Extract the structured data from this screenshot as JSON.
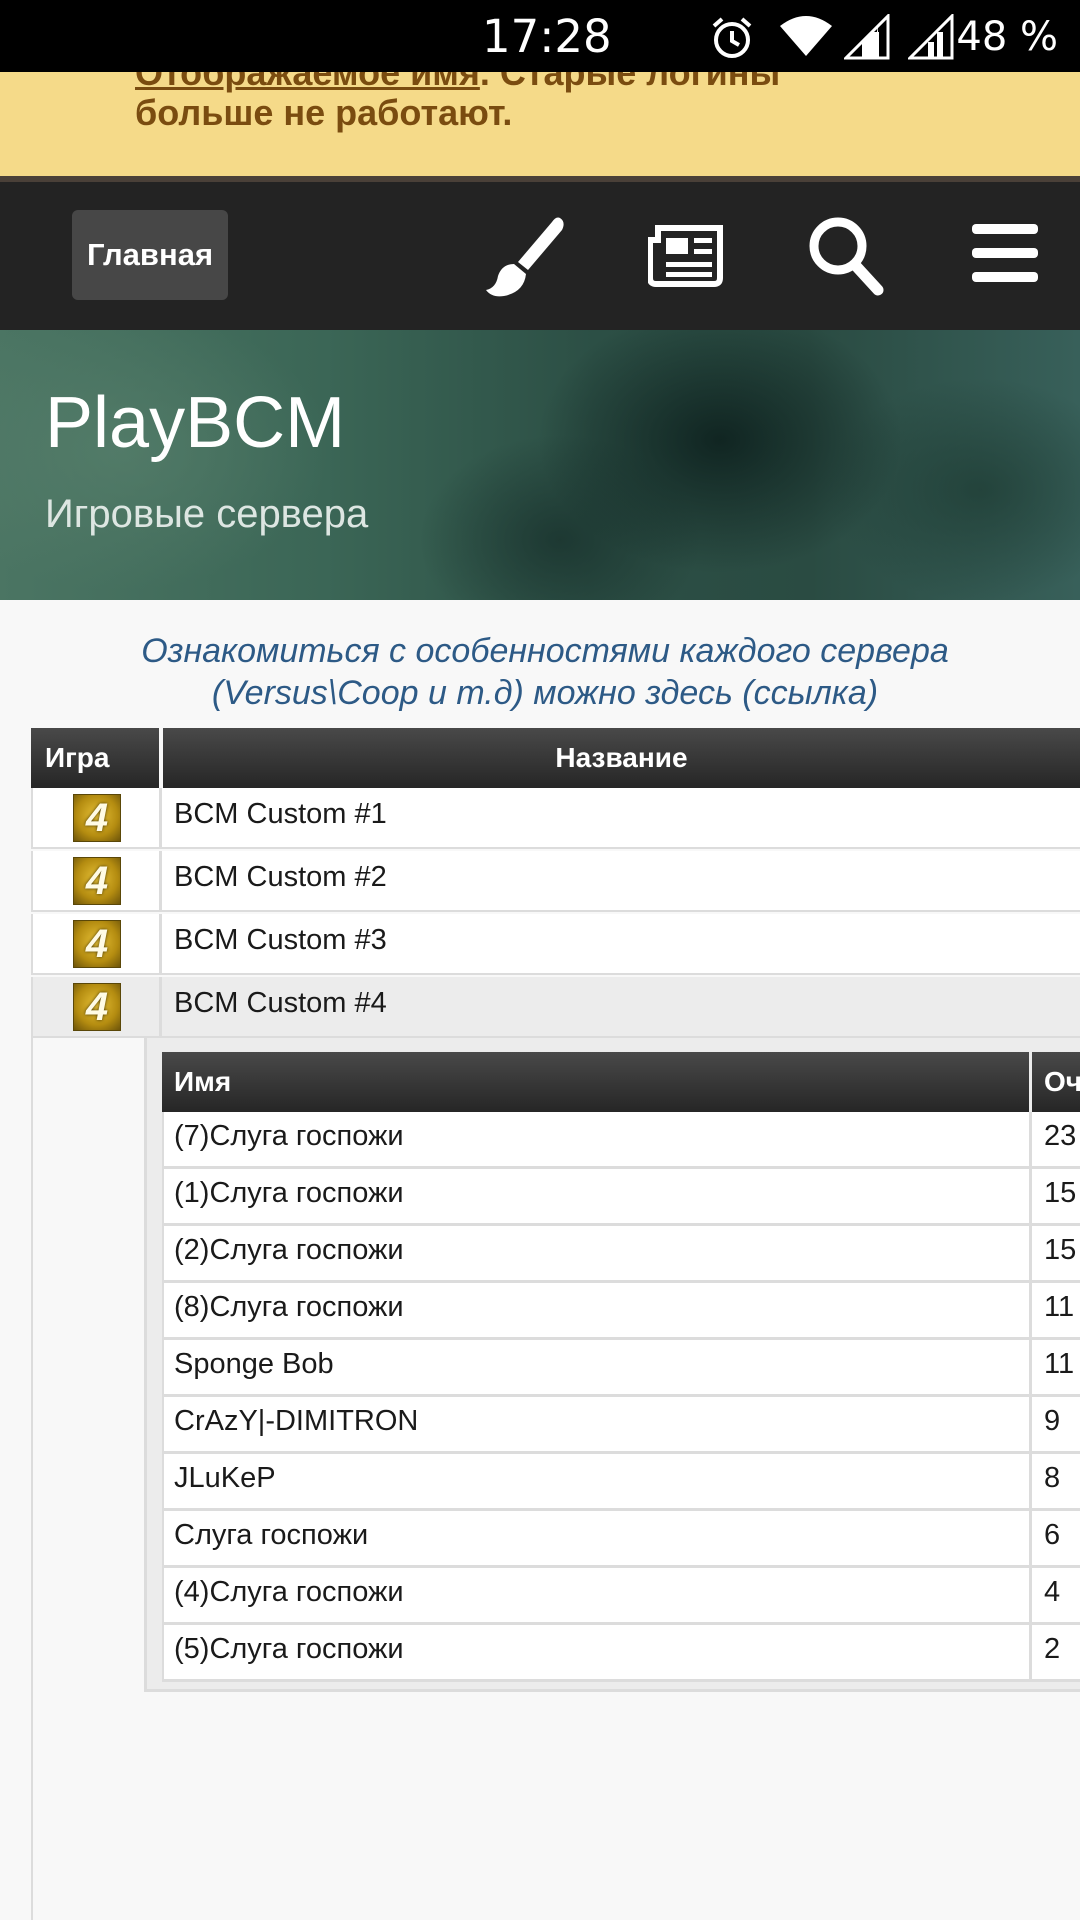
{
  "status_bar": {
    "time": "17:28",
    "battery": "48 %",
    "icons": [
      "alarm-icon",
      "wifi-icon",
      "signal-icon",
      "signal-icon"
    ]
  },
  "notice": {
    "link_text": "Отображаемое имя",
    "line1_rest": ". Старые логины",
    "line2": "больше не работают.",
    "background": "#f5da89",
    "text_color": "#7a4c10"
  },
  "navbar": {
    "home_label": "Главная",
    "icons": [
      "brush-icon",
      "newspaper-icon",
      "search-icon",
      "menu-icon"
    ]
  },
  "banner": {
    "title": "PlayBCM",
    "subtitle": "Игровые сервера"
  },
  "info": {
    "line1": "Ознакомиться с особенностями каждого сервера",
    "line2": "(Versus\\Coop и т.д) можно здесь (ссылка)",
    "color": "#2d5a86"
  },
  "servers": {
    "headers": {
      "game": "Игра",
      "name": "Название"
    },
    "game_icon_text": "4",
    "rows": [
      {
        "name": "BCM Custom #1"
      },
      {
        "name": "BCM Custom #2"
      },
      {
        "name": "BCM Custom #3"
      },
      {
        "name": "BCM Custom #4"
      }
    ]
  },
  "players": {
    "headers": {
      "name": "Имя",
      "score": "Оч"
    },
    "rows": [
      {
        "name": "(7)Слуга госпожи",
        "score": "23"
      },
      {
        "name": "(1)Слуга госпожи",
        "score": "15"
      },
      {
        "name": "(2)Слуга госпожи",
        "score": "15"
      },
      {
        "name": "(8)Слуга госпожи",
        "score": "11"
      },
      {
        "name": "Sponge Bob",
        "score": "11"
      },
      {
        "name": "CrAzY|-DIMITRON",
        "score": "9"
      },
      {
        "name": "JLuKeP",
        "score": "8"
      },
      {
        "name": "Слуга госпожи",
        "score": "6"
      },
      {
        "name": "(4)Слуга госпожи",
        "score": "4"
      },
      {
        "name": "(5)Слуга госпожи",
        "score": "2"
      }
    ]
  }
}
